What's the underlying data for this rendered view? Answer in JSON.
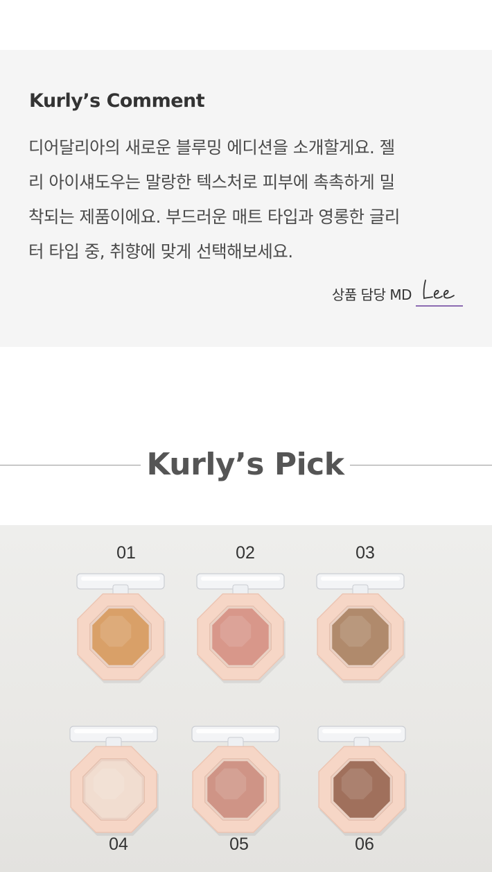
{
  "comment": {
    "title": "Kurly’s Comment",
    "lines": [
      "디어달리아의 새로운 블루밍 에디션을 소개할게요. 젤",
      "리 아이섀도우는 말랑한 텍스처로 피부에 촉촉하게 밀",
      "착되는 제품이에요. 부드러운 매트 타입과 영롱한 글리",
      "터 타입 중, 취향에 맞게 선택해보세요."
    ],
    "md_label": "상품 담당 MD",
    "md_signature": "Lee"
  },
  "pick": {
    "title": "Kurly’s Pick"
  },
  "shades": [
    {
      "number": "01",
      "color": "#d9a068"
    },
    {
      "number": "02",
      "color": "#d8978a"
    },
    {
      "number": "03",
      "color": "#b08a6c"
    },
    {
      "number": "04",
      "color": "#f1ddd0"
    },
    {
      "number": "05",
      "color": "#cf9486"
    },
    {
      "number": "06",
      "color": "#a0705c"
    }
  ],
  "colors": {
    "comment_bg": "#f5f5f5",
    "compact_case": "#f6d6c6",
    "signature": "#8c6bb1"
  }
}
